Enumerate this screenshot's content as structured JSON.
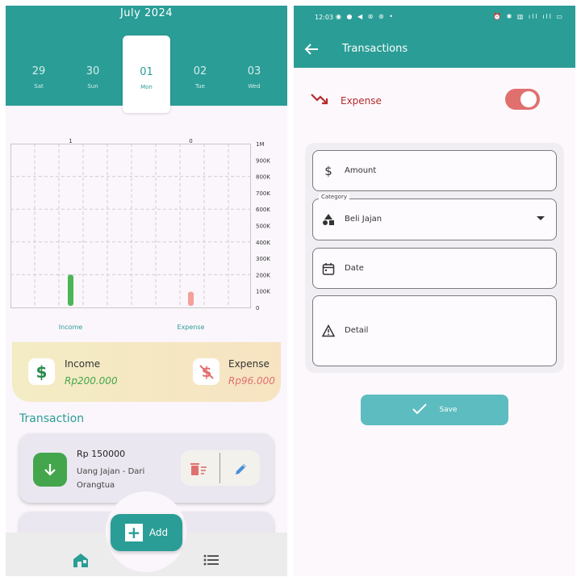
{
  "left": {
    "calendar": {
      "month": "July 2024",
      "days": [
        {
          "num": "29",
          "dow": "Sat"
        },
        {
          "num": "30",
          "dow": "Sun"
        },
        {
          "num": "01",
          "dow": "Mon",
          "selected": true
        },
        {
          "num": "02",
          "dow": "Tue"
        },
        {
          "num": "03",
          "dow": "Wed"
        }
      ]
    },
    "summary": {
      "income_label": "Income",
      "income_value": "Rp200.000",
      "expense_label": "Expense",
      "expense_value": "Rp96.000"
    },
    "section_title": "Transaction",
    "transactions": [
      {
        "amount": "Rp 150000",
        "description": "Uang Jajan - Dari Orangtua",
        "type": "income",
        "icon": "arrow-down-icon"
      }
    ],
    "fab_label": "Add",
    "colors": {
      "primary": "#2a9d96",
      "income": "#43a64c",
      "expense": "#e0706e"
    }
  },
  "chart_data": {
    "type": "bar",
    "categories": [
      "Income",
      "Expense"
    ],
    "values": [
      200000,
      96000
    ],
    "top_labels": [
      "1",
      "0"
    ],
    "ylim": [
      0,
      1000000
    ],
    "yticks": [
      "0",
      "100K",
      "200K",
      "300K",
      "400K",
      "500K",
      "600K",
      "700K",
      "800K",
      "900K",
      "1M"
    ],
    "colors": [
      "#4cb556",
      "#f2a098"
    ],
    "grid": true
  },
  "right": {
    "status_bar": {
      "time": "12:03",
      "left_icons": "◉ ● ◀ ⊛ ⊛ •",
      "right_icons": "⏰ ✱ ▥ ıll ıll ▭"
    },
    "title": "Transactions",
    "type_label": "Expense",
    "fields": {
      "amount_placeholder": "Amount",
      "category_label": "Category",
      "category_value": "Beli Jajan",
      "date_placeholder": "Date",
      "detail_placeholder": "Detail"
    },
    "save_label": "Save"
  }
}
